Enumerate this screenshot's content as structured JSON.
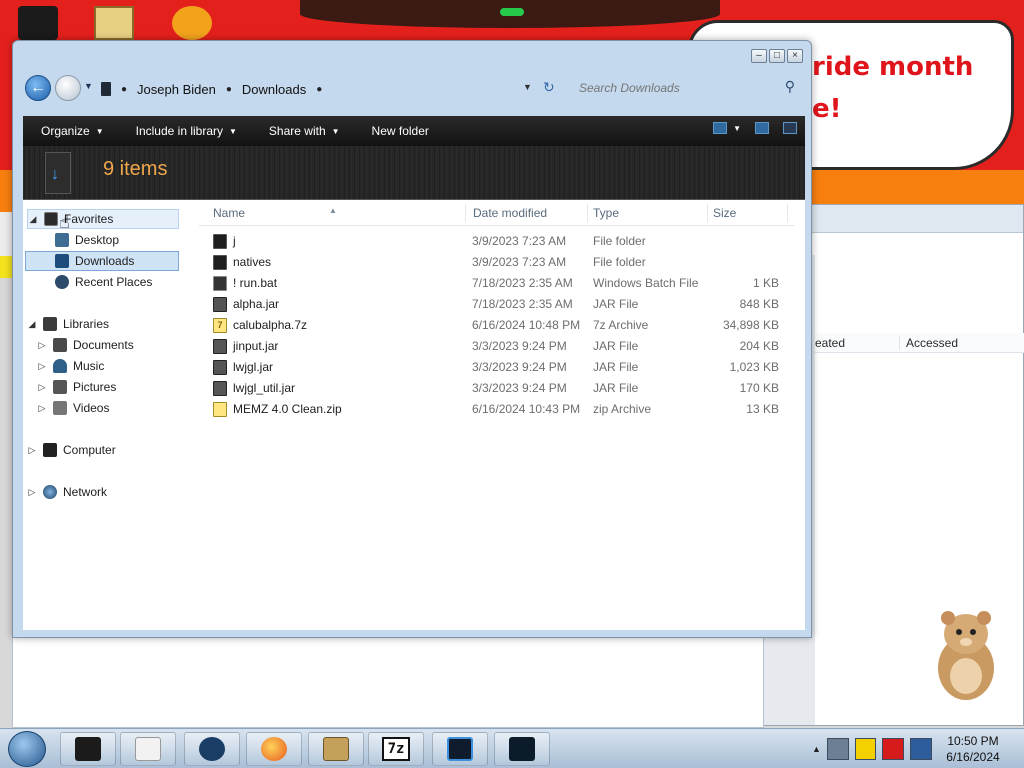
{
  "desktop": {
    "bubble_text": "ride month\ne!"
  },
  "window": {
    "caption_buttons": [
      "minimize",
      "maximize",
      "close"
    ]
  },
  "address_bar": {
    "path": [
      "Joseph Biden",
      "Downloads"
    ],
    "search_placeholder": "Search Downloads"
  },
  "toolbar": {
    "organize": "Organize",
    "include_in_library": "Include in library",
    "share_with": "Share with",
    "new_folder": "New folder"
  },
  "header": {
    "items_count": "9 items"
  },
  "sidebar": {
    "favorites": {
      "label": "Favorites",
      "items": [
        {
          "label": "Desktop",
          "icon": "desktop-icon"
        },
        {
          "label": "Downloads",
          "icon": "downloads-icon",
          "selected": true
        },
        {
          "label": "Recent Places",
          "icon": "recent-places-icon"
        }
      ]
    },
    "libraries": {
      "label": "Libraries",
      "items": [
        {
          "label": "Documents",
          "icon": "documents-icon"
        },
        {
          "label": "Music",
          "icon": "music-icon"
        },
        {
          "label": "Pictures",
          "icon": "pictures-icon"
        },
        {
          "label": "Videos",
          "icon": "videos-icon"
        }
      ]
    },
    "computer": {
      "label": "Computer"
    },
    "network": {
      "label": "Network"
    }
  },
  "file_list": {
    "columns": [
      "Name",
      "Date modified",
      "Type",
      "Size"
    ],
    "rows": [
      {
        "name": "j",
        "date": "3/9/2023 7:23 AM",
        "type": "File folder",
        "size": "",
        "icon": "folder-icon"
      },
      {
        "name": "natives",
        "date": "3/9/2023 7:23 AM",
        "type": "File folder",
        "size": "",
        "icon": "folder-icon"
      },
      {
        "name": "! run.bat",
        "date": "7/18/2023 2:35 AM",
        "type": "Windows Batch File",
        "size": "1 KB",
        "icon": "batch-file-icon"
      },
      {
        "name": "alpha.jar",
        "date": "7/18/2023 2:35 AM",
        "type": "JAR File",
        "size": "848 KB",
        "icon": "jar-file-icon"
      },
      {
        "name": "calubalpha.7z",
        "date": "6/16/2024 10:48 PM",
        "type": "7z Archive",
        "size": "34,898 KB",
        "icon": "archive-7z-icon"
      },
      {
        "name": "jinput.jar",
        "date": "3/3/2023 9:24 PM",
        "type": "JAR File",
        "size": "204 KB",
        "icon": "jar-file-icon"
      },
      {
        "name": "lwjgl.jar",
        "date": "3/3/2023 9:24 PM",
        "type": "JAR File",
        "size": "1,023 KB",
        "icon": "jar-file-icon"
      },
      {
        "name": "lwjgl_util.jar",
        "date": "3/3/2023 9:24 PM",
        "type": "JAR File",
        "size": "170 KB",
        "icon": "jar-file-icon"
      },
      {
        "name": "MEMZ 4.0 Clean.zip",
        "date": "6/16/2024 10:43 PM",
        "type": "zip Archive",
        "size": "13 KB",
        "icon": "zip-archive-icon"
      }
    ]
  },
  "background_window": {
    "columns": [
      "eated",
      "Accessed"
    ]
  },
  "taskbar": {
    "apps": [
      "explorer-app-icon",
      "media-player-app-icon",
      "app-icon",
      "firefox-app-icon",
      "sandbox-app-icon",
      "7zip-app-icon",
      "folder-app-icon",
      "monitor-app-icon"
    ],
    "seven_zip_label": "7z",
    "clock_time": "10:50 PM",
    "clock_date": "6/16/2024"
  }
}
